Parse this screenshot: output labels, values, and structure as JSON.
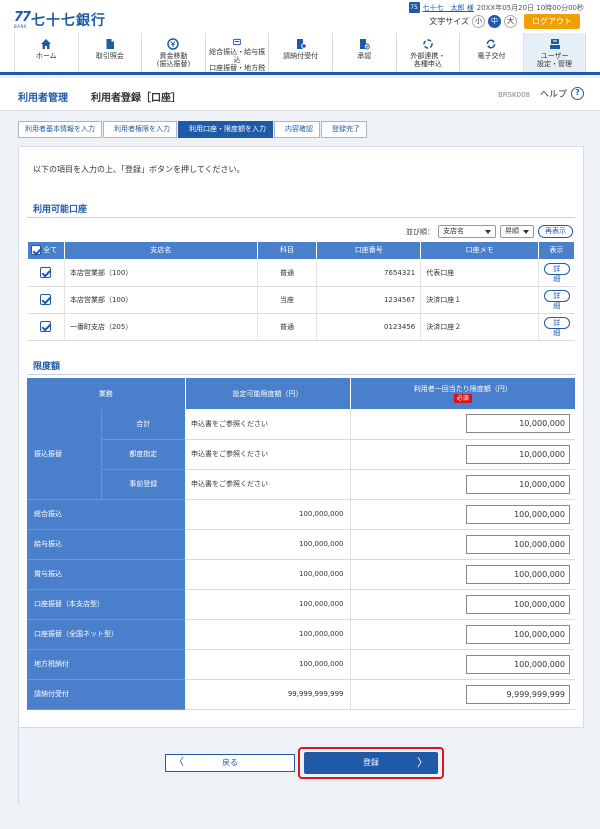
{
  "header": {
    "logo_num": "77",
    "logo_sub": "BANK",
    "bank_name": "七十七銀行",
    "user_badge": "75",
    "user_name": "七十七　太郎 様",
    "login_time": "20XX年05月20日 10時00分00秒",
    "font_size_label": "文字サイズ",
    "font_sizes": [
      "小",
      "中",
      "大"
    ],
    "logout": "ログアウト"
  },
  "gnav": [
    {
      "label": "ホーム",
      "icon": "home-icon"
    },
    {
      "label": "取引照会",
      "icon": "document-icon"
    },
    {
      "label": "資金移動\n(振込振替)",
      "icon": "yen-transfer-icon"
    },
    {
      "label": "総合振込・給与振込\n口座振替・地方税",
      "icon": "card-icon"
    },
    {
      "label": "請納付受付",
      "icon": "payment-icon"
    },
    {
      "label": "承認",
      "icon": "approve-icon"
    },
    {
      "label": "外部連携・\n各種申込",
      "icon": "link-icon"
    },
    {
      "label": "電子交付",
      "icon": "exchange-icon"
    },
    {
      "label": "ユーザー\n設定・管理",
      "icon": "user-settings-icon"
    }
  ],
  "titlebar": {
    "category": "利用者管理",
    "title": "利用者登録［口座］",
    "screen_id": "BRSK008",
    "help": "ヘルプ",
    "help_icon": "?"
  },
  "steps": [
    "利用者基本情報を入力",
    "利用者権限を入力",
    "利用口座・限度額を入力",
    "内容確認",
    "登録完了"
  ],
  "instruction": "以下の項目を入力の上、「登録」ボタンを押してください。",
  "accounts": {
    "section_title": "利用可能口座",
    "sort_label": "並び順：",
    "sort_field": "支店名",
    "sort_order": "昇順",
    "redisplay": "再表示",
    "headers": [
      "全て",
      "支店名",
      "科目",
      "口座番号",
      "口座メモ",
      "表示"
    ],
    "rows": [
      {
        "branch": "本店営業部（100）",
        "type": "普通",
        "number": "7654321",
        "memo": "代表口座",
        "action": "詳細"
      },
      {
        "branch": "本店営業部（100）",
        "type": "当座",
        "number": "1234567",
        "memo": "決済口座１",
        "action": "詳細"
      },
      {
        "branch": "一番町支店（205）",
        "type": "普通",
        "number": "0123456",
        "memo": "決済口座２",
        "action": "詳細"
      }
    ]
  },
  "limits": {
    "section_title": "限度額",
    "headers": {
      "business": "業務",
      "settable": "設定可能限度額（円）",
      "per_tx": "利用者一回当たり限度額（円）",
      "required": "必須"
    },
    "group_label": "振込振替",
    "group_rows": [
      {
        "label": "合計",
        "settable": "申込書をご参照ください",
        "value": "10,000,000"
      },
      {
        "label": "都度指定",
        "settable": "申込書をご参照ください",
        "value": "10,000,000"
      },
      {
        "label": "事前登録",
        "settable": "申込書をご参照ください",
        "value": "10,000,000"
      }
    ],
    "rows": [
      {
        "label": "総合振込",
        "settable": "100,000,000",
        "value": "100,000,000"
      },
      {
        "label": "給与振込",
        "settable": "100,000,000",
        "value": "100,000,000"
      },
      {
        "label": "賞与振込",
        "settable": "100,000,000",
        "value": "100,000,000"
      },
      {
        "label": "口座振替（本支店型）",
        "settable": "100,000,000",
        "value": "100,000,000"
      },
      {
        "label": "口座振替（全国ネット型）",
        "settable": "100,000,000",
        "value": "100,000,000"
      },
      {
        "label": "地方税納付",
        "settable": "100,000,000",
        "value": "100,000,000"
      },
      {
        "label": "請納付受付",
        "settable": "99,999,999,999",
        "value": "9,999,999,999"
      }
    ]
  },
  "buttons": {
    "back": "戻る",
    "submit": "登録",
    "back_arrow": "〈",
    "submit_arrow": "〉"
  }
}
